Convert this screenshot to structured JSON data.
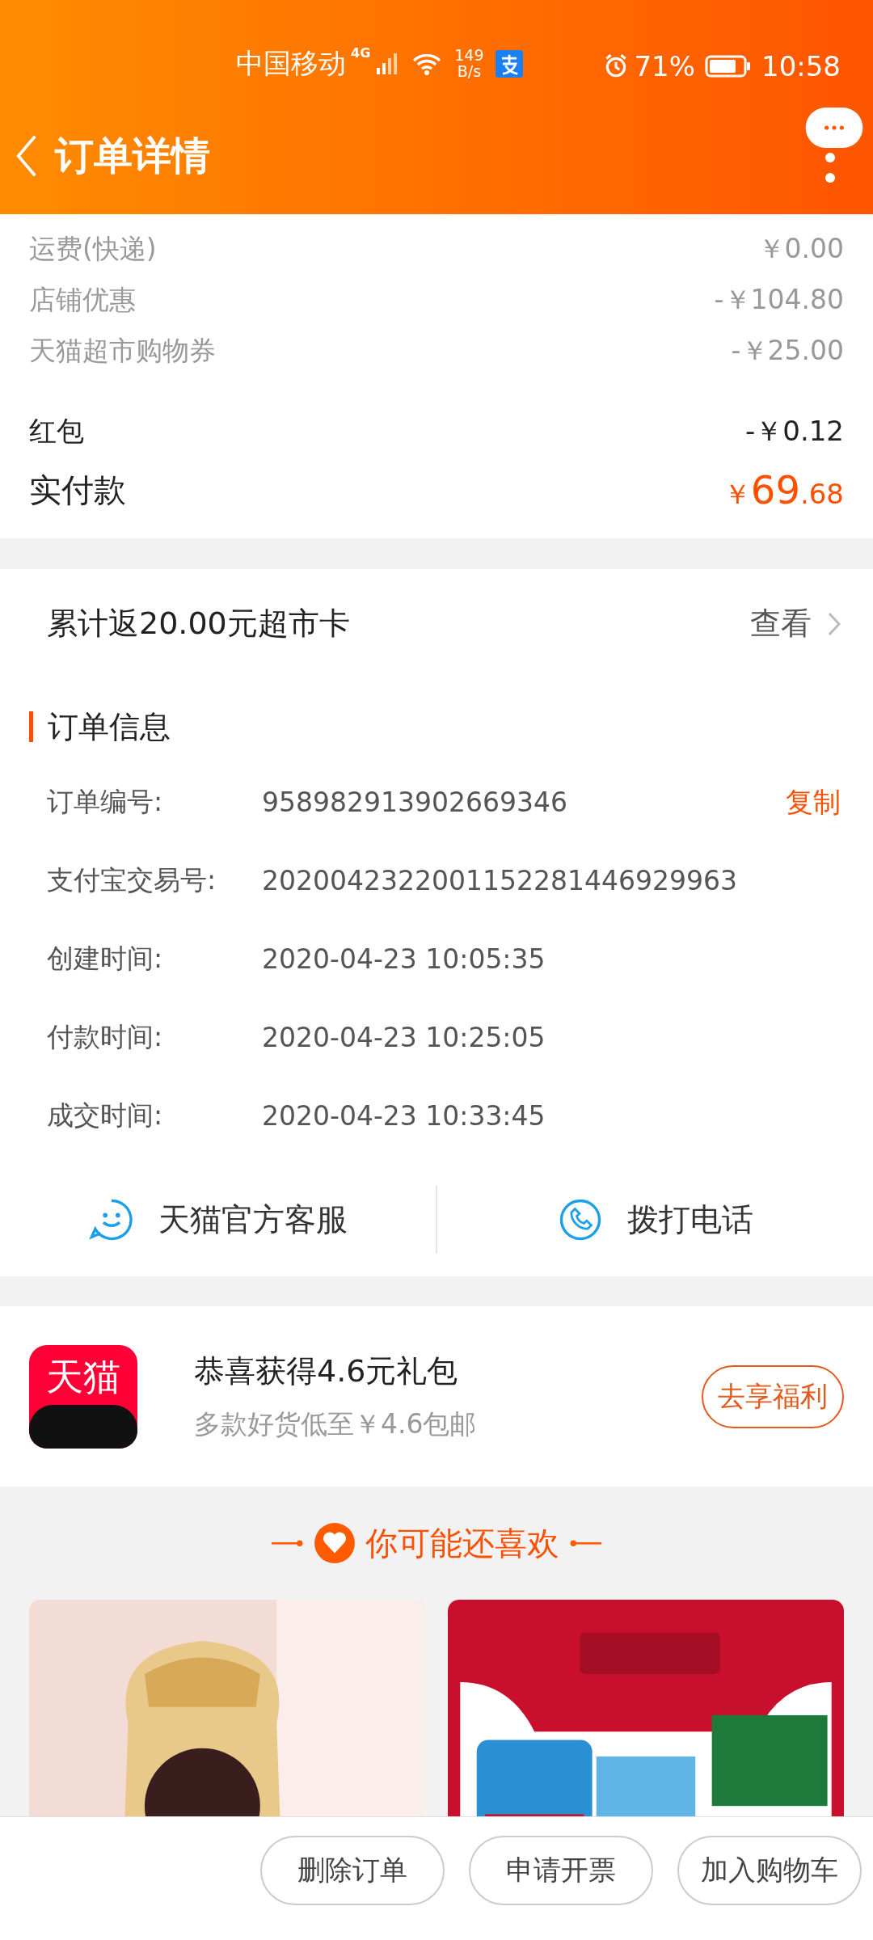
{
  "status_bar": {
    "carrier": "中国移动",
    "network": "4G",
    "speed_value": "149",
    "speed_unit": "B/s",
    "battery_percent": "71%",
    "time": "10:58"
  },
  "header": {
    "title": "订单详情"
  },
  "fees": [
    {
      "label": "运费(快递)",
      "amount": "￥0.00",
      "kind": "minor"
    },
    {
      "label": "店铺优惠",
      "amount": "-￥104.80",
      "kind": "minor"
    },
    {
      "label": "天猫超市购物券",
      "amount": "-￥25.00",
      "kind": "minor"
    },
    {
      "label": "红包",
      "amount": "-￥0.12",
      "kind": "major"
    }
  ],
  "total": {
    "label": "实付款",
    "currency": "￥",
    "integer": "69",
    "decimal": ".68"
  },
  "rebate": {
    "text": "累计返20.00元超市卡",
    "action": "查看"
  },
  "order_info": {
    "title": "订单信息",
    "rows": [
      {
        "label": "订单编号:",
        "value": "958982913902669346",
        "action": "复制"
      },
      {
        "label": "支付宝交易号:",
        "value": "2020042322001152281446929963"
      },
      {
        "label": "创建时间:",
        "value": "2020-04-23 10:05:35"
      },
      {
        "label": "付款时间:",
        "value": "2020-04-23 10:25:05"
      },
      {
        "label": "成交时间:",
        "value": "2020-04-23 10:33:45"
      }
    ]
  },
  "contact": [
    {
      "label": "天猫官方客服",
      "kind": "chat"
    },
    {
      "label": "拨打电话",
      "kind": "phone"
    }
  ],
  "promo": {
    "logo_text": "天猫",
    "title": "恭喜获得4.6元礼包",
    "subtitle": "多款好货低至￥4.6包邮",
    "button": "去享福利"
  },
  "recommend": {
    "title": "你可能还喜欢",
    "products": [
      {
        "kind": "bottle"
      },
      {
        "kind": "cans"
      }
    ]
  },
  "actions": [
    "删除订单",
    "申请开票",
    "加入购物车"
  ]
}
